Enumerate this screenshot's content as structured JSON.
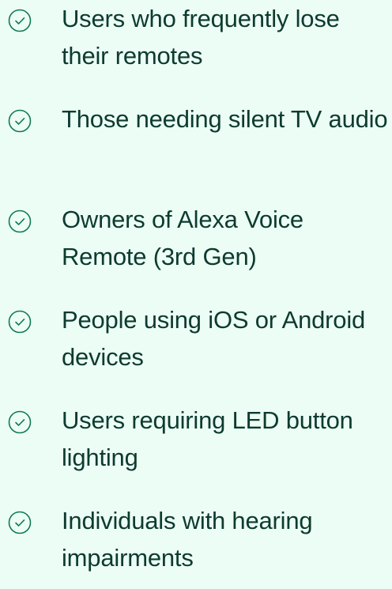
{
  "colors": {
    "background": "#ecfdf5",
    "text": "#0d3b2f",
    "icon": "#0f7a54"
  },
  "icon_name": "check-circle-icon",
  "items": [
    {
      "text": "Users who frequently lose their remotes"
    },
    {
      "text": "Those needing silent TV audio"
    },
    {
      "text": "Owners of Alexa Voice Remote (3rd Gen)"
    },
    {
      "text": "People using iOS or Android devices"
    },
    {
      "text": "Users requiring LED button lighting"
    },
    {
      "text": "Individuals with hearing impairments"
    }
  ]
}
